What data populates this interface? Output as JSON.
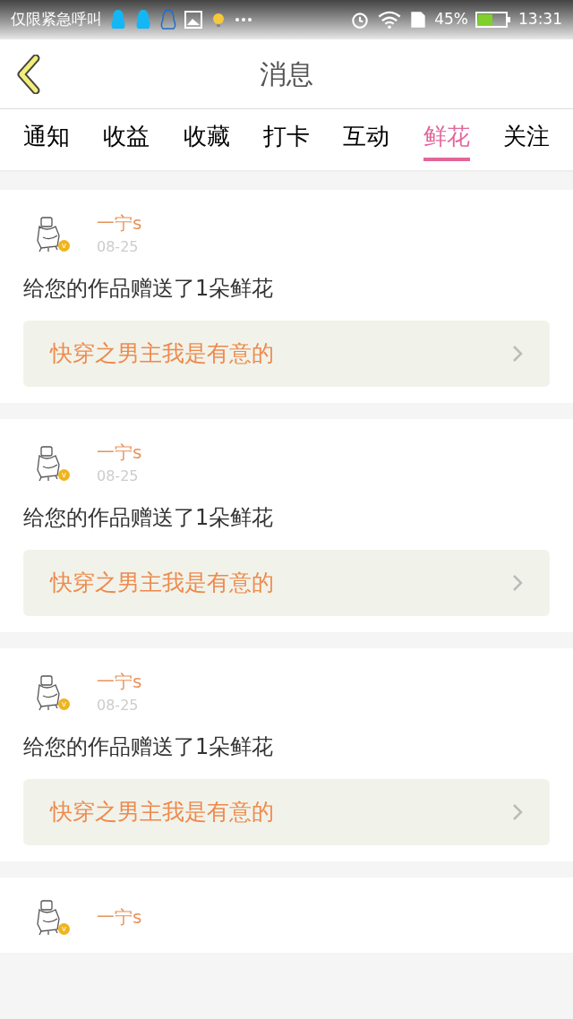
{
  "status_bar": {
    "carrier": "仅限紧急呼叫",
    "battery_percent": "45%",
    "time": "13:31"
  },
  "header": {
    "title": "消息"
  },
  "tabs": [
    {
      "label": "通知",
      "selected": false
    },
    {
      "label": "收益",
      "selected": false
    },
    {
      "label": "收藏",
      "selected": false
    },
    {
      "label": "打卡",
      "selected": false
    },
    {
      "label": "互动",
      "selected": false
    },
    {
      "label": "鲜花",
      "selected": true
    },
    {
      "label": "关注",
      "selected": false
    }
  ],
  "messages": [
    {
      "user": "一宁s",
      "badge": "v",
      "date": "08-25",
      "text": "给您的作品赠送了1朵鲜花",
      "work": "快穿之男主我是有意的"
    },
    {
      "user": "一宁s",
      "badge": "v",
      "date": "08-25",
      "text": "给您的作品赠送了1朵鲜花",
      "work": "快穿之男主我是有意的"
    },
    {
      "user": "一宁s",
      "badge": "v",
      "date": "08-25",
      "text": "给您的作品赠送了1朵鲜花",
      "work": "快穿之男主我是有意的"
    },
    {
      "user": "一宁s",
      "badge": "v"
    }
  ]
}
